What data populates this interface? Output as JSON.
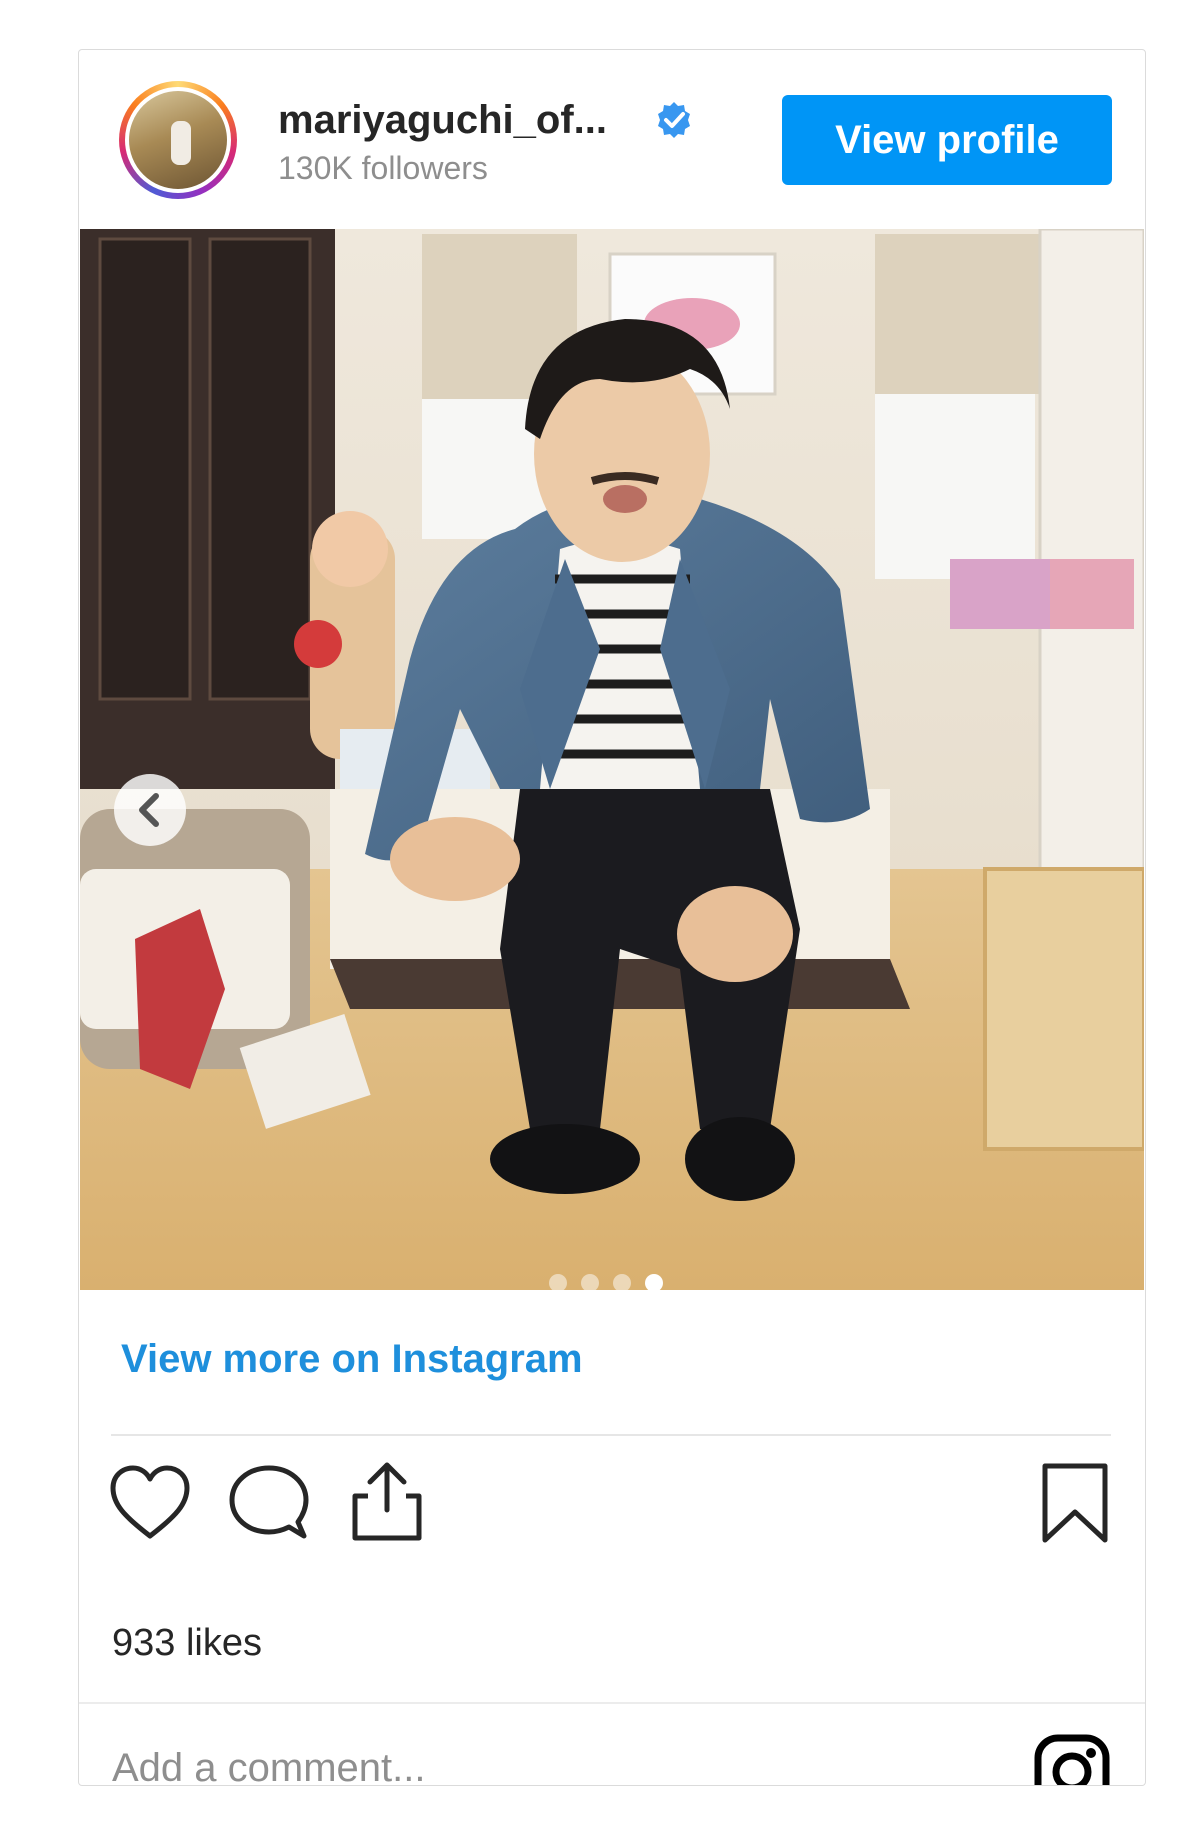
{
  "header": {
    "username": "mariyaguchi_of...",
    "verified_icon": "verified-badge-icon",
    "followers": "130K followers",
    "view_profile_label": "View profile"
  },
  "post": {
    "carousel": {
      "current_slide": 4,
      "total_slides": 4
    },
    "view_more_label": "View more on Instagram",
    "likes": "933 likes",
    "comment_placeholder": "Add a comment...",
    "icons": [
      "heart-icon",
      "comment-icon",
      "share-icon",
      "bookmark-icon",
      "instagram-logo-icon",
      "chevron-left-icon"
    ]
  },
  "colors": {
    "accent": "#0095f6",
    "link": "#1e8fdc",
    "text_primary": "#262626",
    "text_secondary": "#8e8e8e"
  }
}
